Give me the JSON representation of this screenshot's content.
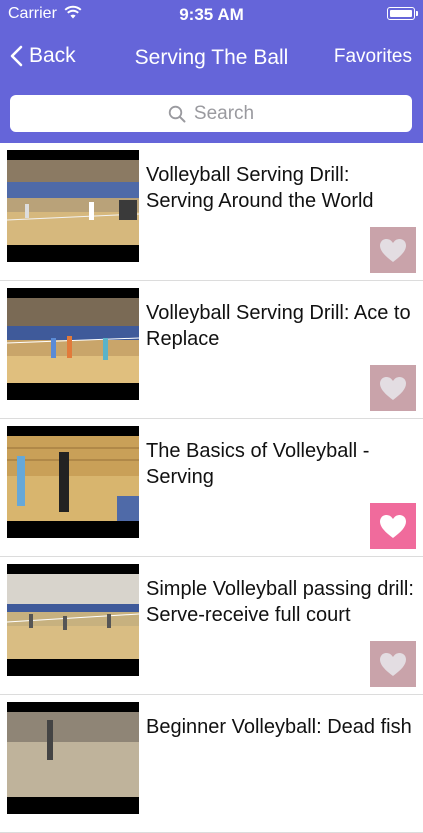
{
  "status_bar": {
    "carrier": "Carrier",
    "time": "9:35 AM"
  },
  "nav": {
    "back_label": "Back",
    "title": "Serving The Ball",
    "favorites_label": "Favorites"
  },
  "search": {
    "placeholder": "Search"
  },
  "colors": {
    "nav_bg": "#6565d9",
    "heart_inactive": "#c9a3aa",
    "heart_active": "#f06b9c"
  },
  "videos": [
    {
      "title": "Volleyball Serving Drill: Serving Around the World",
      "favorite": false
    },
    {
      "title": "Volleyball Serving Drill: Ace to Replace",
      "favorite": false
    },
    {
      "title": "The Basics of Volleyball - Serving",
      "favorite": true
    },
    {
      "title": "Simple Volleyball passing drill: Serve-receive full court",
      "favorite": false
    },
    {
      "title": "Beginner Volleyball: Dead fish",
      "favorite": false
    }
  ]
}
